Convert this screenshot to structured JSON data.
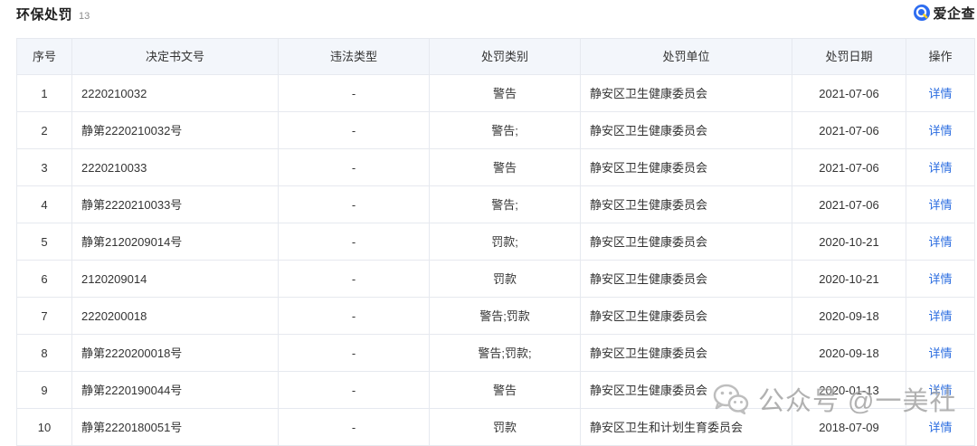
{
  "section": {
    "title": "环保处罚",
    "count": "13"
  },
  "brand": {
    "name": "爱企查",
    "icon": "search-q-icon",
    "color": "#2d6cf0"
  },
  "table": {
    "headers": [
      "序号",
      "决定书文号",
      "违法类型",
      "处罚类别",
      "处罚单位",
      "处罚日期",
      "操作"
    ],
    "rows": [
      {
        "index": "1",
        "doc_no": "2220210032",
        "violation_type": "-",
        "penalty_category": "警告",
        "authority": "静安区卫生健康委员会",
        "date": "2021-07-06",
        "action": "详情"
      },
      {
        "index": "2",
        "doc_no": "静第2220210032号",
        "violation_type": "-",
        "penalty_category": "警告;",
        "authority": "静安区卫生健康委员会",
        "date": "2021-07-06",
        "action": "详情"
      },
      {
        "index": "3",
        "doc_no": "2220210033",
        "violation_type": "-",
        "penalty_category": "警告",
        "authority": "静安区卫生健康委员会",
        "date": "2021-07-06",
        "action": "详情"
      },
      {
        "index": "4",
        "doc_no": "静第2220210033号",
        "violation_type": "-",
        "penalty_category": "警告;",
        "authority": "静安区卫生健康委员会",
        "date": "2021-07-06",
        "action": "详情"
      },
      {
        "index": "5",
        "doc_no": "静第2120209014号",
        "violation_type": "-",
        "penalty_category": "罚款;",
        "authority": "静安区卫生健康委员会",
        "date": "2020-10-21",
        "action": "详情"
      },
      {
        "index": "6",
        "doc_no": "2120209014",
        "violation_type": "-",
        "penalty_category": "罚款",
        "authority": "静安区卫生健康委员会",
        "date": "2020-10-21",
        "action": "详情"
      },
      {
        "index": "7",
        "doc_no": "2220200018",
        "violation_type": "-",
        "penalty_category": "警告;罚款",
        "authority": "静安区卫生健康委员会",
        "date": "2020-09-18",
        "action": "详情"
      },
      {
        "index": "8",
        "doc_no": "静第2220200018号",
        "violation_type": "-",
        "penalty_category": "警告;罚款;",
        "authority": "静安区卫生健康委员会",
        "date": "2020-09-18",
        "action": "详情"
      },
      {
        "index": "9",
        "doc_no": "静第2220190044号",
        "violation_type": "-",
        "penalty_category": "警告",
        "authority": "静安区卫生健康委员会",
        "date": "2020-01-13",
        "action": "详情"
      },
      {
        "index": "10",
        "doc_no": "静第2220180051号",
        "violation_type": "-",
        "penalty_category": "罚款",
        "authority": "静安区卫生和计划生育委员会",
        "date": "2018-07-09",
        "action": "详情"
      }
    ]
  },
  "watermark": {
    "text": "公众号 @一美社",
    "icon": "wechat-icon"
  },
  "colors": {
    "link": "#2b6de0",
    "header_bg": "#f3f6fb",
    "border": "#e6e9ef"
  }
}
